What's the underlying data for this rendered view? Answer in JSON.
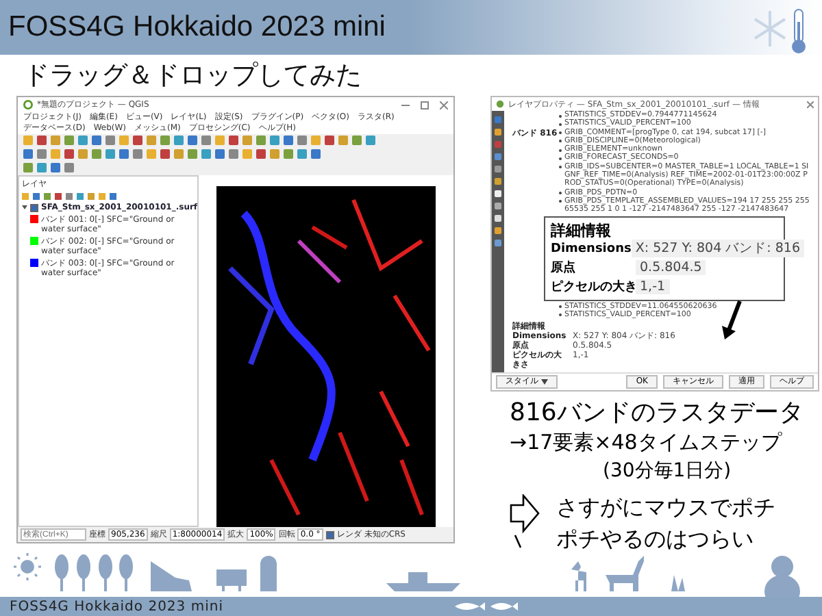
{
  "header": {
    "title": "FOSS4G Hokkaido 2023 mini"
  },
  "slide_title": "ドラッグ＆ドロップしてみた",
  "qgis_window": {
    "title": "*無題のプロジェクト — QGIS",
    "menu": [
      "プロジェクト(J)",
      "編集(E)",
      "ビュー(V)",
      "レイヤ(L)",
      "設定(S)",
      "プラグイン(P)",
      "ベクタ(O)",
      "ラスタ(R)",
      "データベース(D)",
      "Web(W)",
      "メッシュ(M)",
      "プロセシング(C)",
      "ヘルプ(H)"
    ],
    "layers_panel": {
      "title": "レイヤ",
      "layer": {
        "name": "SFA_Stm_sx_2001_20010101_.surf",
        "checked": true,
        "expanded": true,
        "bands": [
          {
            "label": "バンド 001: 0[-] SFC=\"Ground or water surface\"",
            "color": "#ff0000"
          },
          {
            "label": "バンド 002: 0[-] SFC=\"Ground or water surface\"",
            "color": "#00ff00"
          },
          {
            "label": "バンド 003: 0[-] SFC=\"Ground or water surface\"",
            "color": "#0000ff"
          }
        ]
      }
    },
    "status_bar": {
      "search_placeholder": "検索(Ctrl+K)",
      "fields": [
        {
          "label": "座標",
          "value": "905,236"
        },
        {
          "label": "縮尺",
          "value": "1:80000014"
        },
        {
          "label": "拡大",
          "value": "100%"
        },
        {
          "label": "回転",
          "value": "0.0 °"
        }
      ],
      "render": {
        "label": "レンダ",
        "checked": true
      },
      "crs": "未知のCRS"
    }
  },
  "properties_dialog": {
    "title": "レイヤプロパティ — SFA_Stm_sx_2001_20010101_.surf — 情報",
    "top_lines": [
      "STATISTICS_STDDEV=0.7944771145624",
      "STATISTICS_VALID_PERCENT=100"
    ],
    "band_label": "バンド 816",
    "band_lines": [
      "GRIB_COMMENT=[progType 0, cat 194, subcat 17] [-]",
      "GRIB_DISCIPLINE=0(Meteorological)",
      "GRIB_ELEMENT=unknown",
      "GRIB_FORECAST_SECONDS=0",
      "GRIB_IDS=SUBCENTER=0 MASTER_TABLE=1 LOCAL_TABLE=1 SIGNF_REF_TIME=0(Analysis) REF_TIME=2002-01-01T23:00:00Z PROD_STATUS=0(Operational) TYPE=0(Analysis)",
      "GRIB_PDS_PDTN=0",
      "GRIB_PDS_TEMPLATE_ASSEMBLED_VALUES=194 17 255 255 255 65535 255 1 0 1 -127 -2147483647 255 -127 -2147483647"
    ],
    "after_lines": [
      "STATISTICS_STDDEV=11.064550620636",
      "STATISTICS_VALID_PERCENT=100"
    ],
    "details": {
      "heading": "詳細情報",
      "rows": [
        {
          "label": "Dimensions",
          "value": "X: 527 Y: 804 バンド: 816"
        },
        {
          "label": "原点",
          "value": "0.5.804.5"
        },
        {
          "label": "ピクセルの大きさ",
          "value": "1,-1"
        }
      ]
    },
    "style_button": "スタイル",
    "buttons": [
      "OK",
      "キャンセル",
      "適用",
      "ヘルプ"
    ]
  },
  "zoomed_details": {
    "heading": "詳細情報",
    "rows": [
      {
        "label": "Dimensions",
        "value": "X: 527 Y: 804 バンド: 816"
      },
      {
        "label": "原点",
        "value": "0.5.804.5"
      },
      {
        "label": "ピクセルの大き",
        "value": "1,-1"
      }
    ]
  },
  "notes": {
    "heading": "816バンドのラスタデータ",
    "line_2": "→17要素×48タイムステップ",
    "line_3": "(30分毎1日分)",
    "callout_lines": [
      "さすがにマウスでポチ",
      "ポチやるのはつらい"
    ]
  },
  "footer": {
    "text": "FOSS4G Hokkaido 2023 mini"
  }
}
